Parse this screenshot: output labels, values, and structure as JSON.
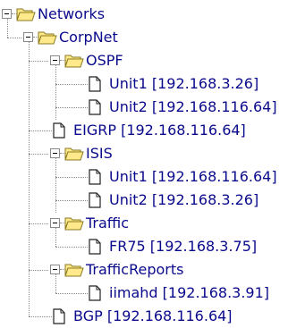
{
  "tree": {
    "root": {
      "label": "Networks",
      "expanded": true
    },
    "corpnet": {
      "label": "CorpNet",
      "expanded": true
    },
    "ospf": {
      "label": "OSPF",
      "expanded": true
    },
    "ospf_unit1": {
      "label": "Unit1 [192.168.3.26]"
    },
    "ospf_unit2": {
      "label": "Unit2 [192.168.116.64]"
    },
    "eigrp": {
      "label": "EIGRP [192.168.116.64]"
    },
    "isis": {
      "label": "ISIS",
      "expanded": true
    },
    "isis_unit1": {
      "label": "Unit1 [192.168.116.64]"
    },
    "isis_unit2": {
      "label": "Unit2 [192.168.3.26]"
    },
    "traffic": {
      "label": "Traffic",
      "expanded": true
    },
    "fr75": {
      "label": "FR75 [192.168.3.75]"
    },
    "trafficreports": {
      "label": "TrafficReports",
      "expanded": true
    },
    "iimahd": {
      "label": "iimahd [192.168.3.91]"
    },
    "bgp": {
      "label": "BGP [192.168.116.64]"
    }
  },
  "icons": {
    "folder": "folder-open-icon",
    "document": "document-icon",
    "expander": "collapse-minus-icon"
  },
  "colors": {
    "text": "#0a0a8c",
    "folder_fill": "#ffe98a",
    "folder_stroke": "#8a7a20",
    "tree_lines": "#8a8a8a"
  }
}
